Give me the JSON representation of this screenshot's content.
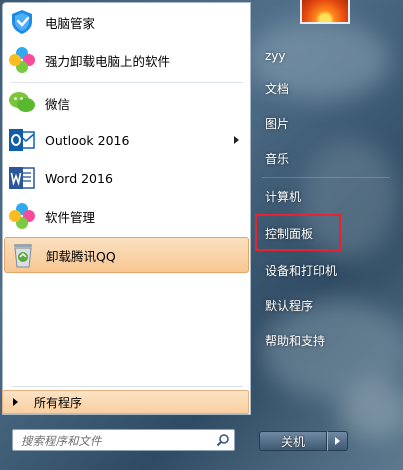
{
  "programs": [
    {
      "label": "电脑管家",
      "icon": "tencent-pc-manager-icon",
      "has_arrow": false
    },
    {
      "label": "强力卸载电脑上的软件",
      "icon": "uninstall-clover-icon",
      "has_arrow": false
    },
    {
      "label": "微信",
      "icon": "wechat-icon",
      "has_arrow": false
    },
    {
      "label": "Outlook 2016",
      "icon": "outlook-icon",
      "has_arrow": true
    },
    {
      "label": "Word 2016",
      "icon": "word-icon",
      "has_arrow": false
    },
    {
      "label": "软件管理",
      "icon": "software-manager-clover-icon",
      "has_arrow": false
    },
    {
      "label": "卸载腾讯QQ",
      "icon": "recycle-bin-icon",
      "has_arrow": false,
      "selected": true
    }
  ],
  "all_programs_label": "所有程序",
  "search": {
    "placeholder": "搜索程序和文件"
  },
  "right_items": [
    {
      "label": "zyy"
    },
    {
      "label": "文档"
    },
    {
      "label": "图片"
    },
    {
      "label": "音乐"
    },
    {
      "label": "计算机"
    },
    {
      "label": "控制面板",
      "highlighted": true
    },
    {
      "label": "设备和打印机"
    },
    {
      "label": "默认程序"
    },
    {
      "label": "帮助和支持"
    }
  ],
  "shutdown_label": "关机",
  "colors": {
    "highlight_border": "#e8232f",
    "selected_bg": "#f7c791"
  }
}
